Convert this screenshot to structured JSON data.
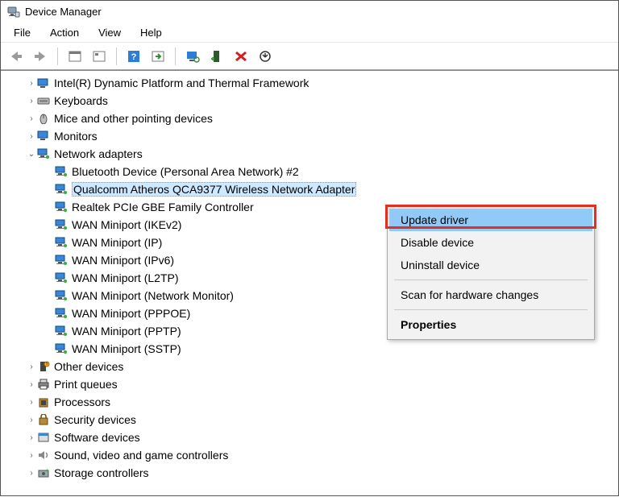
{
  "window": {
    "title": "Device Manager"
  },
  "menubar": [
    "File",
    "Action",
    "View",
    "Help"
  ],
  "tree": [
    {
      "indent": 1,
      "expander": ">",
      "icon": "platform",
      "label": "Intel(R) Dynamic Platform and Thermal Framework"
    },
    {
      "indent": 1,
      "expander": ">",
      "icon": "keyboard",
      "label": "Keyboards"
    },
    {
      "indent": 1,
      "expander": ">",
      "icon": "mouse",
      "label": "Mice and other pointing devices"
    },
    {
      "indent": 1,
      "expander": ">",
      "icon": "monitor",
      "label": "Monitors"
    },
    {
      "indent": 1,
      "expander": "v",
      "icon": "network",
      "label": "Network adapters"
    },
    {
      "indent": 2,
      "expander": "",
      "icon": "network",
      "label": "Bluetooth Device (Personal Area Network) #2"
    },
    {
      "indent": 2,
      "expander": "",
      "icon": "network",
      "label": "Qualcomm Atheros QCA9377 Wireless Network Adapter",
      "selected": true
    },
    {
      "indent": 2,
      "expander": "",
      "icon": "network",
      "label": "Realtek PCIe GBE Family Controller"
    },
    {
      "indent": 2,
      "expander": "",
      "icon": "network",
      "label": "WAN Miniport (IKEv2)"
    },
    {
      "indent": 2,
      "expander": "",
      "icon": "network",
      "label": "WAN Miniport (IP)"
    },
    {
      "indent": 2,
      "expander": "",
      "icon": "network",
      "label": "WAN Miniport (IPv6)"
    },
    {
      "indent": 2,
      "expander": "",
      "icon": "network",
      "label": "WAN Miniport (L2TP)"
    },
    {
      "indent": 2,
      "expander": "",
      "icon": "network",
      "label": "WAN Miniport (Network Monitor)"
    },
    {
      "indent": 2,
      "expander": "",
      "icon": "network",
      "label": "WAN Miniport (PPPOE)"
    },
    {
      "indent": 2,
      "expander": "",
      "icon": "network",
      "label": "WAN Miniport (PPTP)"
    },
    {
      "indent": 2,
      "expander": "",
      "icon": "network",
      "label": "WAN Miniport (SSTP)"
    },
    {
      "indent": 1,
      "expander": ">",
      "icon": "other",
      "label": "Other devices"
    },
    {
      "indent": 1,
      "expander": ">",
      "icon": "printer",
      "label": "Print queues"
    },
    {
      "indent": 1,
      "expander": ">",
      "icon": "cpu",
      "label": "Processors"
    },
    {
      "indent": 1,
      "expander": ">",
      "icon": "security",
      "label": "Security devices"
    },
    {
      "indent": 1,
      "expander": ">",
      "icon": "software",
      "label": "Software devices"
    },
    {
      "indent": 1,
      "expander": ">",
      "icon": "audio",
      "label": "Sound, video and game controllers"
    },
    {
      "indent": 1,
      "expander": ">",
      "icon": "storage",
      "label": "Storage controllers"
    }
  ],
  "context_menu": {
    "items": [
      {
        "label": "Update driver",
        "highlighted": true
      },
      {
        "label": "Disable device"
      },
      {
        "label": "Uninstall device"
      },
      {
        "sep": true
      },
      {
        "label": "Scan for hardware changes"
      },
      {
        "sep": true
      },
      {
        "label": "Properties",
        "bold": true
      }
    ]
  }
}
